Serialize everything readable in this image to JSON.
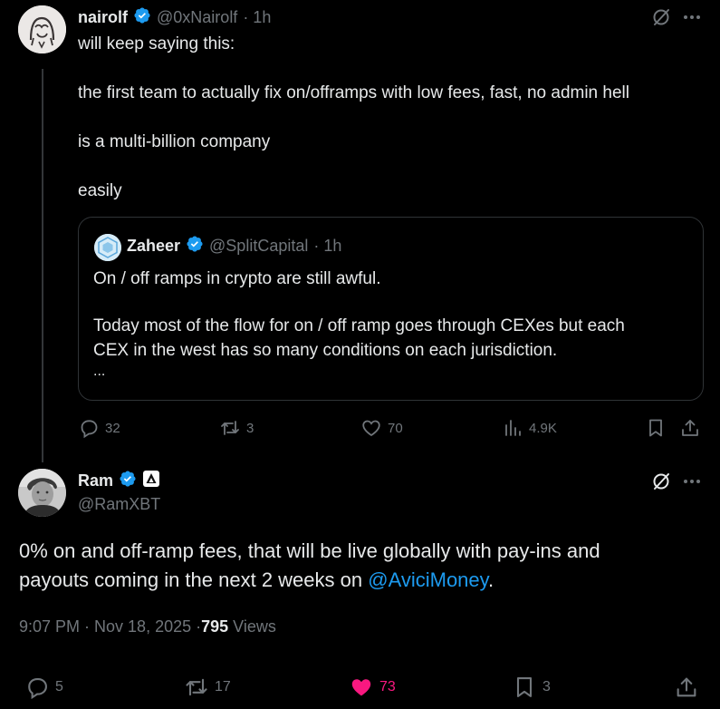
{
  "tweet1": {
    "display_name": "nairolf",
    "handle": "@0xNairolf",
    "time": "· 1h",
    "lines": [
      "will keep saying this:",
      "the first team to actually fix on/offramps with low fees, fast, no admin hell",
      "is a multi-billion company",
      "easily"
    ],
    "quote": {
      "display_name": "Zaheer",
      "handle": "@SplitCapital",
      "time": "· 1h",
      "line1": "On / off ramps in crypto are still awful.",
      "line2": "Today most of the flow for on / off ramp goes through CEXes but each",
      "line3": "CEX in the west has so many conditions on each jurisdiction.",
      "ellipsis": "..."
    },
    "actions": {
      "replies": "32",
      "reposts": "3",
      "likes": "70",
      "views": "4.9K"
    }
  },
  "tweet2": {
    "display_name": "Ram",
    "handle": "@RamXBT",
    "text_line1": "0% on and off-ramp fees, that will be live globally with pay-ins and",
    "text_line2_prefix": "payouts coming in the next 2 weeks on ",
    "mention": "@AviciMoney",
    "text_line2_suffix": ".",
    "timestamp": "9:07 PM · Nov 18, 2025 · ",
    "views_count": "795",
    "views_label": "Views",
    "actions": {
      "replies": "5",
      "reposts": "17",
      "likes": "73",
      "bookmarks": "3"
    }
  },
  "colors": {
    "background": "#000000",
    "text": "#e7e9ea",
    "muted": "#71767b",
    "link": "#1d9bf0",
    "verified": "#1d9bf0",
    "like_active": "#f91880",
    "border": "#2f3336"
  },
  "icons": [
    "reply-icon",
    "repost-icon",
    "like-icon",
    "views-icon",
    "bookmark-icon",
    "share-icon",
    "grok-icon",
    "more-icon",
    "verified-badge-icon"
  ]
}
